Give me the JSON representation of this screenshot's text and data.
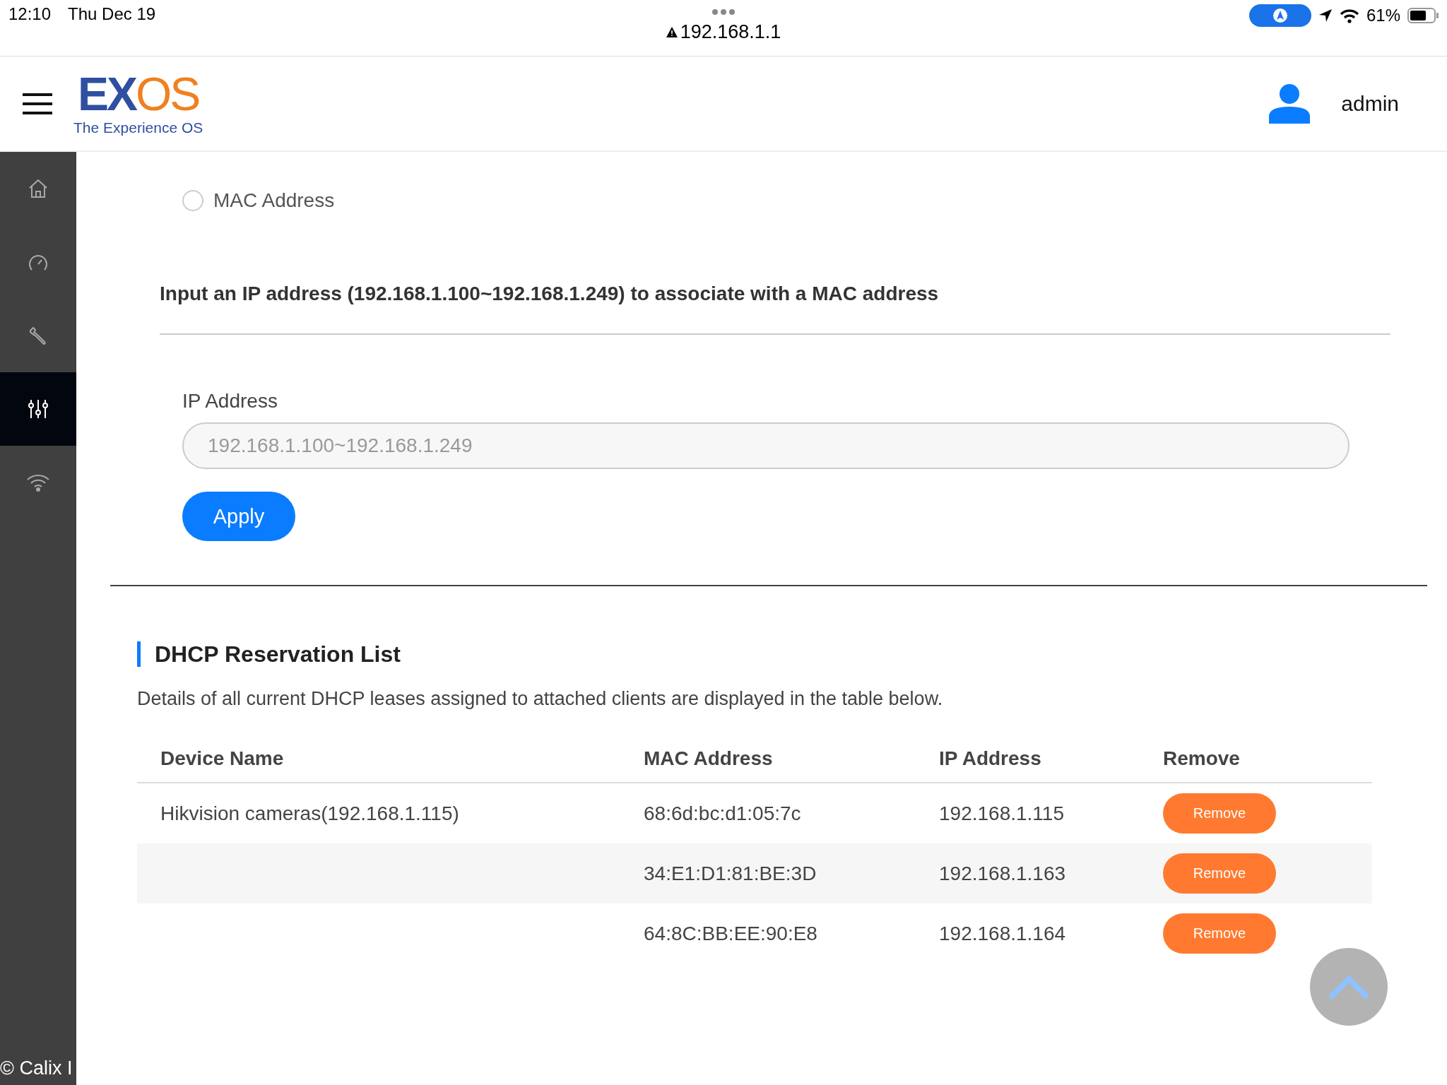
{
  "status_bar": {
    "time": "12:10",
    "date": "Thu Dec 19",
    "url": "192.168.1.1",
    "battery": "61%"
  },
  "header": {
    "logo_main_a": "EX",
    "logo_main_b": "OS",
    "logo_tagline": "The Experience OS",
    "user": "admin"
  },
  "sidebar": {
    "items": [
      {
        "selected": false
      },
      {
        "selected": false
      },
      {
        "selected": false
      },
      {
        "selected": true
      },
      {
        "selected": false
      }
    ],
    "footer": "© Calix I"
  },
  "reservation_form": {
    "radio": {
      "label": "MAC Address",
      "selected": false
    },
    "instruction": "Input an IP address (192.168.1.100~192.168.1.249) to associate with a MAC address",
    "ip_field": {
      "label": "IP Address",
      "placeholder": "192.168.1.100~192.168.1.249"
    },
    "apply_button": "Apply"
  },
  "dhcp_list": {
    "title": "DHCP Reservation List",
    "description": "Details of all current DHCP leases assigned to attached clients are displayed in the table below.",
    "columns": [
      "Device Name",
      "MAC Address",
      "IP Address",
      "Remove"
    ],
    "rows": [
      {
        "device": "Hikvision cameras(192.168.1.115)",
        "mac": "68:6d:bc:d1:05:7c",
        "ip": "192.168.1.115",
        "action": "Remove"
      },
      {
        "device": "",
        "mac": "34:E1:D1:81:BE:3D",
        "ip": "192.168.1.163",
        "action": "Remove"
      },
      {
        "device": "",
        "mac": "64:8C:BB:EE:90:E8",
        "ip": "192.168.1.164",
        "action": "Remove"
      }
    ]
  }
}
